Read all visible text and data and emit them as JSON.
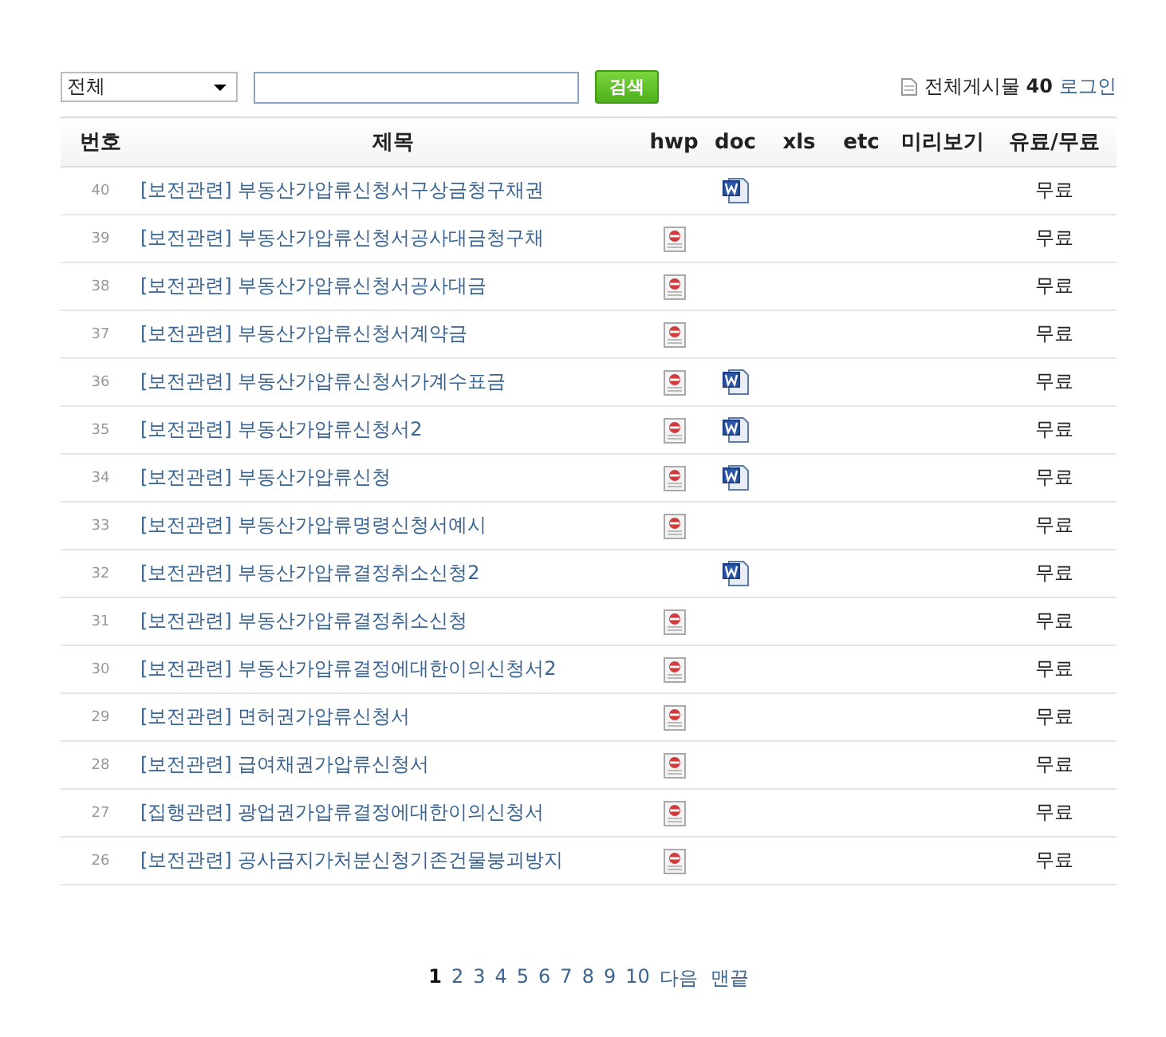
{
  "search": {
    "category": "전체",
    "button": "검색"
  },
  "summary": {
    "total": "전체게시물 **40**",
    "login": "로그인"
  },
  "table": {
    "columns": [
      "번호",
      "제목",
      "hwp",
      "doc",
      "xls",
      "etc",
      "미리보기",
      "유료/무료"
    ],
    "rows": [
      {
        "no": "40",
        "title": "[보전관련] 부동산가압류신청서구상금청구채권",
        "hwp": false,
        "doc": true,
        "price": "무료"
      },
      {
        "no": "39",
        "title": "[보전관련] 부동산가압류신청서공사대금청구채",
        "hwp": true,
        "doc": false,
        "price": "무료"
      },
      {
        "no": "38",
        "title": "[보전관련] 부동산가압류신청서공사대금",
        "hwp": true,
        "doc": false,
        "price": "무료"
      },
      {
        "no": "37",
        "title": "[보전관련] 부동산가압류신청서계약금",
        "hwp": true,
        "doc": false,
        "price": "무료"
      },
      {
        "no": "36",
        "title": "[보전관련] 부동산가압류신청서가계수표금",
        "hwp": true,
        "doc": true,
        "price": "무료"
      },
      {
        "no": "35",
        "title": "[보전관련] 부동산가압류신청서2",
        "hwp": true,
        "doc": true,
        "price": "무료"
      },
      {
        "no": "34",
        "title": "[보전관련] 부동산가압류신청",
        "hwp": true,
        "doc": true,
        "price": "무료"
      },
      {
        "no": "33",
        "title": "[보전관련] 부동산가압류명령신청서예시",
        "hwp": true,
        "doc": false,
        "price": "무료"
      },
      {
        "no": "32",
        "title": "[보전관련] 부동산가압류결정취소신청2",
        "hwp": false,
        "doc": true,
        "price": "무료"
      },
      {
        "no": "31",
        "title": "[보전관련] 부동산가압류결정취소신청",
        "hwp": true,
        "doc": false,
        "price": "무료"
      },
      {
        "no": "30",
        "title": "[보전관련] 부동산가압류결정에대한이의신청서2",
        "hwp": true,
        "doc": false,
        "price": "무료"
      },
      {
        "no": "29",
        "title": "[보전관련] 면허권가압류신청서",
        "hwp": true,
        "doc": false,
        "price": "무료"
      },
      {
        "no": "28",
        "title": "[보전관련] 급여채권가압류신청서",
        "hwp": true,
        "doc": false,
        "price": "무료"
      },
      {
        "no": "27",
        "title": "[집행관련] 광업권가압류결정에대한이의신청서",
        "hwp": true,
        "doc": false,
        "price": "무료"
      },
      {
        "no": "26",
        "title": "[보전관련] 공사금지가처분신청기존건물붕괴방지",
        "hwp": true,
        "doc": false,
        "price": "무료"
      }
    ]
  },
  "pagination": {
    "pages": [
      {
        "label": "1",
        "selected": true
      },
      {
        "label": "2",
        "selected": false
      },
      {
        "label": "3",
        "selected": false
      },
      {
        "label": "4",
        "selected": false
      },
      {
        "label": "5",
        "selected": false
      },
      {
        "label": "6",
        "selected": false
      },
      {
        "label": "7",
        "selected": false
      },
      {
        "label": "8",
        "selected": false
      },
      {
        "label": "9",
        "selected": false
      },
      {
        "label": "10",
        "selected": false
      }
    ],
    "next": "다음",
    "last": "맨끝"
  }
}
